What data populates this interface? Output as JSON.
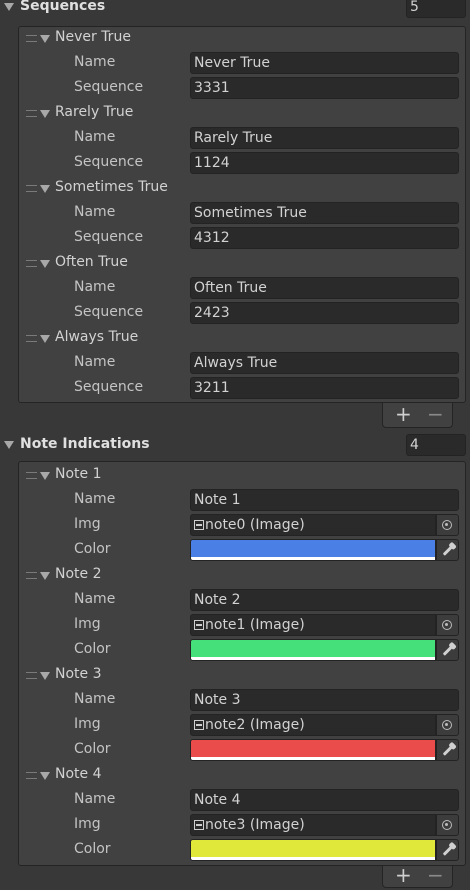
{
  "sequences": {
    "title": "Sequences",
    "count": "5",
    "items": [
      {
        "header": "Never True",
        "name_label": "Name",
        "name": "Never True",
        "seq_label": "Sequence",
        "sequence": "3331"
      },
      {
        "header": "Rarely True",
        "name_label": "Name",
        "name": "Rarely True",
        "seq_label": "Sequence",
        "sequence": "1124"
      },
      {
        "header": "Sometimes True",
        "name_label": "Name",
        "name": "Sometimes True",
        "seq_label": "Sequence",
        "sequence": "4312"
      },
      {
        "header": "Often True",
        "name_label": "Name",
        "name": "Often True",
        "seq_label": "Sequence",
        "sequence": "2423"
      },
      {
        "header": "Always True",
        "name_label": "Name",
        "name": "Always True",
        "seq_label": "Sequence",
        "sequence": "3211"
      }
    ],
    "add_label": "+",
    "remove_label": "−"
  },
  "notes": {
    "title": "Note Indications",
    "count": "4",
    "items": [
      {
        "header": "Note 1",
        "name_label": "Name",
        "name": "Note 1",
        "img_label": "Img",
        "img": "note0 (Image)",
        "color_label": "Color",
        "color": "#4a7fe6"
      },
      {
        "header": "Note 2",
        "name_label": "Name",
        "name": "Note 2",
        "img_label": "Img",
        "img": "note1 (Image)",
        "color_label": "Color",
        "color": "#46e07a"
      },
      {
        "header": "Note 3",
        "name_label": "Name",
        "name": "Note 3",
        "img_label": "Img",
        "img": "note2 (Image)",
        "color_label": "Color",
        "color": "#ea4b4b"
      },
      {
        "header": "Note 4",
        "name_label": "Name",
        "name": "Note 4",
        "img_label": "Img",
        "img": "note3 (Image)",
        "color_label": "Color",
        "color": "#e0e83a"
      }
    ],
    "add_label": "+",
    "remove_label": "−"
  }
}
